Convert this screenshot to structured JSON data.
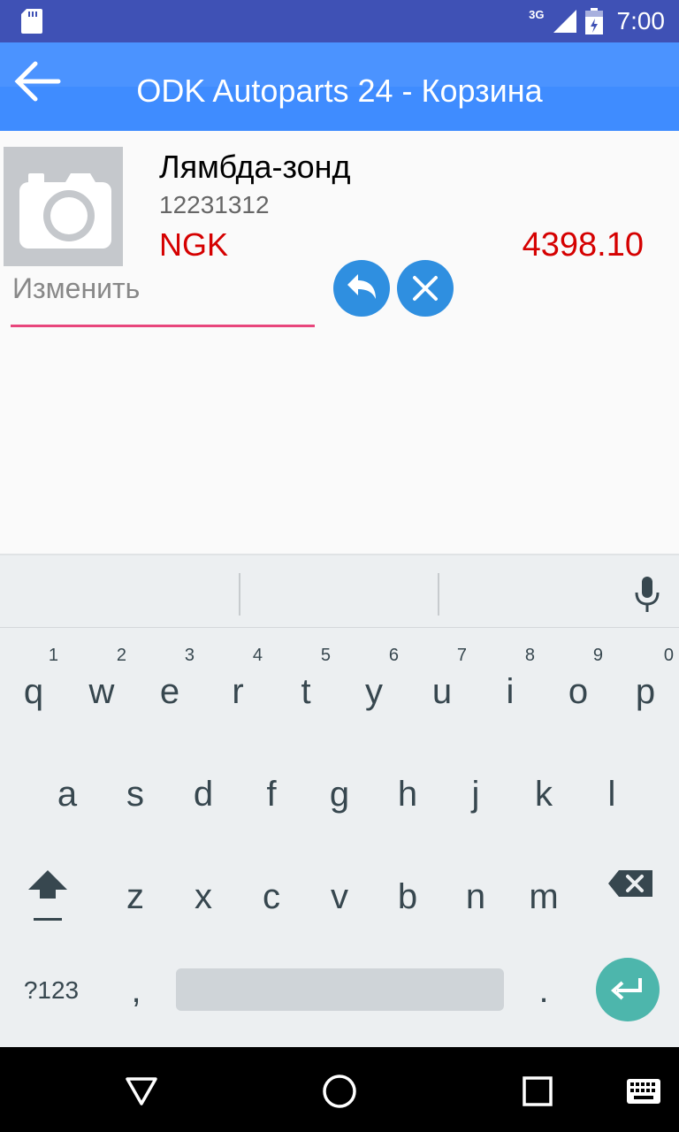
{
  "status_bar": {
    "network": "3G",
    "time": "7:00"
  },
  "app_bar": {
    "title": "ODK Autoparts 24 - Корзина",
    "back_icon": "arrow-back-icon"
  },
  "cart_item": {
    "name": "Лямбда-зонд",
    "code": "12231312",
    "brand": "NGK",
    "price": "4398.10",
    "image_icon": "camera-icon",
    "edit_placeholder": "Изменить"
  },
  "colors": {
    "status_bar": "#3f51b5",
    "app_bar": "#3f8cff",
    "price_red": "#d50000",
    "field_underline": "#e8467c",
    "action_blue": "#2f8fe0",
    "enter_teal": "#4db6ac"
  },
  "keyboard": {
    "row1": [
      {
        "letter": "q",
        "num": "1"
      },
      {
        "letter": "w",
        "num": "2"
      },
      {
        "letter": "e",
        "num": "3"
      },
      {
        "letter": "r",
        "num": "4"
      },
      {
        "letter": "t",
        "num": "5"
      },
      {
        "letter": "y",
        "num": "6"
      },
      {
        "letter": "u",
        "num": "7"
      },
      {
        "letter": "i",
        "num": "8"
      },
      {
        "letter": "o",
        "num": "9"
      },
      {
        "letter": "p",
        "num": "0"
      }
    ],
    "row2": [
      "a",
      "s",
      "d",
      "f",
      "g",
      "h",
      "j",
      "k",
      "l"
    ],
    "row3": [
      "z",
      "x",
      "c",
      "v",
      "b",
      "n",
      "m"
    ],
    "symbols_label": "?123",
    "comma": ",",
    "period": "."
  }
}
